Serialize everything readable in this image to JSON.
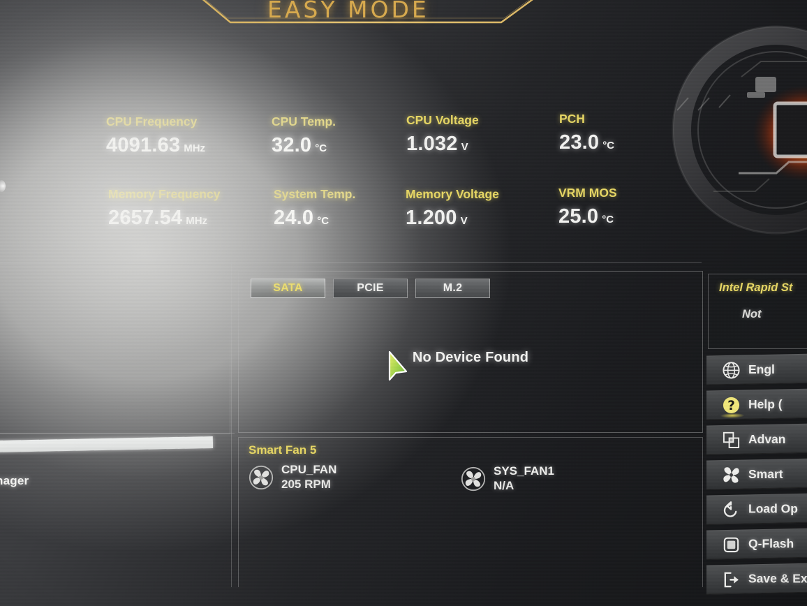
{
  "header": {
    "title": "EASY MODE"
  },
  "monitor": [
    {
      "label": "CPU Frequency",
      "value": "4091.63",
      "unit": "MHz",
      "washed": true
    },
    {
      "label": "CPU Temp.",
      "value": "32.0",
      "unit": "°C",
      "washed": true
    },
    {
      "label": "CPU Voltage",
      "value": "1.032",
      "unit": "V",
      "washed": false
    },
    {
      "label": "PCH",
      "value": "23.0",
      "unit": "°C",
      "washed": false
    },
    {
      "label": "Memory Frequency",
      "value": "2657.54",
      "unit": "MHz",
      "washed": true
    },
    {
      "label": "System Temp.",
      "value": "24.0",
      "unit": "°C",
      "washed": true
    },
    {
      "label": "Memory Voltage",
      "value": "1.200",
      "unit": "V",
      "washed": false
    },
    {
      "label": "VRM MOS",
      "value": "25.0",
      "unit": "°C",
      "washed": false
    }
  ],
  "storage": {
    "tabs": [
      {
        "label": "SATA",
        "active": true
      },
      {
        "label": "PCIE",
        "active": false
      },
      {
        "label": "M.2",
        "active": false
      }
    ],
    "empty_message": "No Device Found"
  },
  "smart_fan": {
    "title": "Smart Fan 5",
    "fans": [
      {
        "name": "CPU_FAN",
        "reading": "205 RPM",
        "icon": "fan-icon"
      },
      {
        "name": "SYS_FAN1",
        "reading": "N/A",
        "icon": "fan-icon"
      }
    ]
  },
  "intel_rapid_start": {
    "title": "Intel Rapid St",
    "status": "Not"
  },
  "menu": [
    {
      "label": "Engl",
      "icon": "globe-icon",
      "glow": false
    },
    {
      "label": "Help (",
      "icon": "question-mark-icon",
      "glow": true
    },
    {
      "label": "Advan",
      "icon": "advanced-mode-icon",
      "glow": false
    },
    {
      "label": "Smart ",
      "icon": "fan-icon",
      "glow": false
    },
    {
      "label": "Load Op",
      "icon": "undo-arrow-icon",
      "glow": false
    },
    {
      "label": "Q-Flash",
      "icon": "chip-icon",
      "glow": false
    },
    {
      "label": "Save & Ex",
      "icon": "exit-arrow-icon",
      "glow": false
    }
  ],
  "left_edge": {
    "cut_label": "nager"
  },
  "colors": {
    "accent_gold": "#d8aa4e",
    "label_yellow": "#e7d764",
    "value_white": "#f2f2f0",
    "panel_border": "#b4b4b4",
    "tab_active_text": "#efe06a"
  }
}
